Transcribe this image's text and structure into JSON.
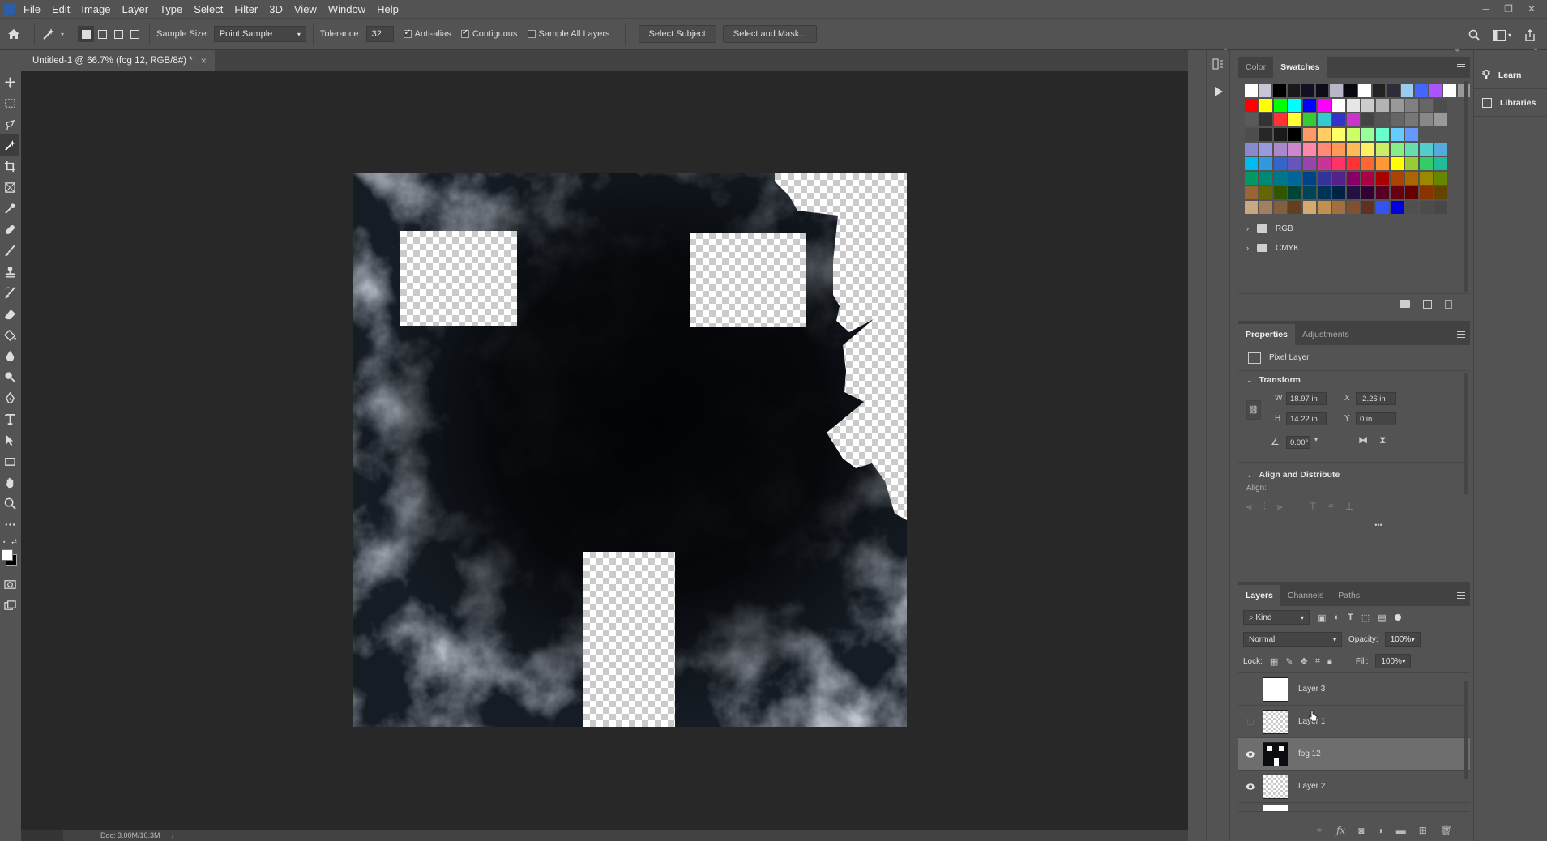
{
  "menu": {
    "items": [
      "File",
      "Edit",
      "Image",
      "Layer",
      "Type",
      "Select",
      "Filter",
      "3D",
      "View",
      "Window",
      "Help"
    ]
  },
  "options": {
    "sample_size_label": "Sample Size:",
    "sample_size_value": "Point Sample",
    "tolerance_label": "Tolerance:",
    "tolerance_value": "32",
    "anti_alias": "Anti-alias",
    "anti_alias_checked": true,
    "contiguous": "Contiguous",
    "contiguous_checked": true,
    "sample_all_layers": "Sample All Layers",
    "sample_all_layers_checked": false,
    "select_subject": "Select Subject",
    "select_and_mask": "Select and Mask..."
  },
  "document": {
    "tab_title": "Untitled-1 @ 66.7% (fog 12, RGB/8#) *",
    "close": "×"
  },
  "status": {
    "doc_info": "Doc: 3.00M/10.3M",
    "arrow": "›"
  },
  "swatches_panel": {
    "tabs": [
      "Color",
      "Swatches"
    ],
    "active_tab": "Swatches",
    "groups": [
      "RGB",
      "CMYK"
    ]
  },
  "properties_panel": {
    "tabs": [
      "Properties",
      "Adjustments"
    ],
    "layer_type": "Pixel Layer",
    "transform_title": "Transform",
    "w_label": "W",
    "w_value": "18.97 in",
    "h_label": "H",
    "h_value": "14.22 in",
    "x_label": "X",
    "x_value": "-2.26 in",
    "y_label": "Y",
    "y_value": "0 in",
    "angle_value": "0.00°",
    "align_title": "Align and Distribute",
    "align_label": "Align:",
    "more": "•••"
  },
  "layers_panel": {
    "tabs": [
      "Layers",
      "Channels",
      "Paths"
    ],
    "filter_label": "Kind",
    "blend_mode": "Normal",
    "opacity_label": "Opacity:",
    "opacity_value": "100%",
    "lock_label": "Lock:",
    "fill_label": "Fill:",
    "fill_value": "100%",
    "layers": [
      {
        "name": "Layer 3",
        "visible": false,
        "selected": false
      },
      {
        "name": "Layer 1",
        "visible": false,
        "selected": false
      },
      {
        "name": "fog 12",
        "visible": true,
        "selected": true
      },
      {
        "name": "Layer 2",
        "visible": true,
        "selected": false
      }
    ]
  },
  "right_dock": {
    "learn": "Learn",
    "libraries": "Libraries"
  },
  "colors": {
    "ui_bg": "#535353",
    "canvas_bg": "#282828",
    "selected_layer": "#6e6e6e"
  }
}
